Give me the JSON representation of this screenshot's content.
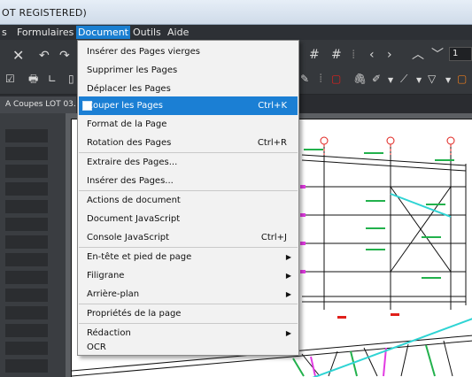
{
  "window": {
    "title": "OT REGISTERED)"
  },
  "menubar": {
    "items": [
      {
        "label": "s"
      },
      {
        "label": "Formulaires"
      },
      {
        "label": "Document"
      },
      {
        "label": "Outils"
      },
      {
        "label": "Aide"
      }
    ]
  },
  "toolbar": {
    "page_number": "1"
  },
  "tabs": [
    {
      "label": "A Coupes LOT 03."
    }
  ],
  "document_menu": {
    "items": [
      {
        "label": "Insérer des Pages vierges",
        "shortcut": "",
        "submenu": false
      },
      {
        "label": "Supprimer les Pages",
        "shortcut": "",
        "submenu": false
      },
      {
        "label": "Déplacer les Pages",
        "shortcut": "",
        "submenu": false
      },
      {
        "label": "Couper les Pages",
        "shortcut": "Ctrl+K",
        "submenu": false,
        "highlighted": true
      },
      {
        "label": "Format de la Page",
        "shortcut": "",
        "submenu": false
      },
      {
        "label": "Rotation des Pages",
        "shortcut": "Ctrl+R",
        "submenu": false
      },
      {
        "label": "Extraire des Pages...",
        "shortcut": "",
        "submenu": false
      },
      {
        "label": "Insérer des Pages...",
        "shortcut": "",
        "submenu": false
      },
      {
        "label": "Actions de document",
        "shortcut": "",
        "submenu": false
      },
      {
        "label": "Document JavaScript",
        "shortcut": "",
        "submenu": false
      },
      {
        "label": "Console JavaScript",
        "shortcut": "Ctrl+J",
        "submenu": false
      },
      {
        "label": "En-tête et pied de page",
        "shortcut": "",
        "submenu": true
      },
      {
        "label": "Filigrane",
        "shortcut": "",
        "submenu": true
      },
      {
        "label": "Arrière-plan",
        "shortcut": "",
        "submenu": true
      },
      {
        "label": "Propriétés de la page",
        "shortcut": "",
        "submenu": false
      },
      {
        "label": "Rédaction",
        "shortcut": "",
        "submenu": true
      },
      {
        "label": "OCR",
        "shortcut": "",
        "submenu": false
      }
    ]
  },
  "colors": {
    "menu_highlight": "#1b7fd4",
    "drawing_red": "#e0201b",
    "drawing_green": "#22b14c",
    "drawing_cyan": "#2fd4d4",
    "drawing_magenta": "#e23be2"
  }
}
